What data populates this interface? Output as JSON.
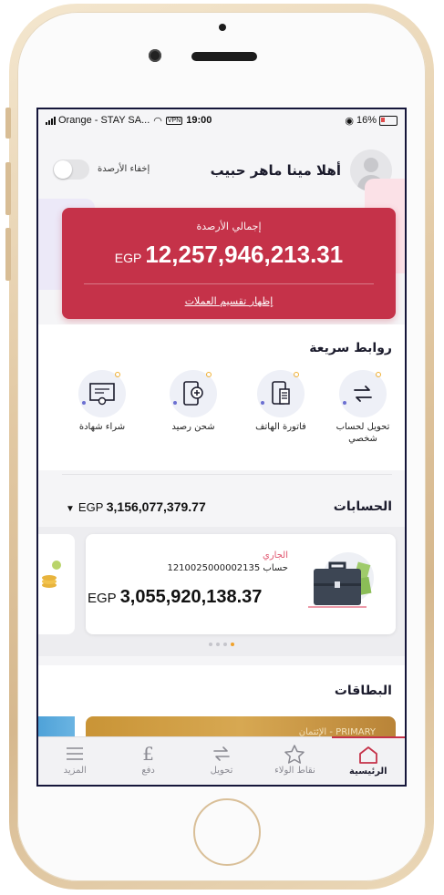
{
  "status_bar": {
    "carrier": "Orange - STAY SA...",
    "vpn": "VPN",
    "time": "19:00",
    "battery": "16%"
  },
  "header": {
    "greeting": "أهلا مينا ماهر حبيب",
    "hide_balances_label": "إخفاء الأرصدة"
  },
  "balance_card": {
    "label": "إجمالي الأرصدة",
    "currency": "EGP",
    "amount": "12,257,946,213.31",
    "link": "إظهار تقسيم العملات",
    "color": "#c53249"
  },
  "quick_links": {
    "title": "روابط سريعة",
    "items": [
      {
        "label": "تحويل لحساب شخصي",
        "icon": "transfer-icon"
      },
      {
        "label": "فاتورة الهاتف",
        "icon": "phone-bill-icon"
      },
      {
        "label": "شحن رصيد",
        "icon": "phone-topup-icon"
      },
      {
        "label": "شراء شهادة",
        "icon": "certificate-icon"
      }
    ]
  },
  "accounts": {
    "title": "الحسابات",
    "total_currency": "EGP",
    "total_amount": "3,156,077,379.77",
    "card": {
      "type": "الجاري",
      "number": "حساب 1210025000002135",
      "currency": "EGP",
      "amount": "3,055,920,138.37"
    }
  },
  "cards": {
    "title": "البطاقات",
    "card_label": "الإئتمان - PRIMARY"
  },
  "tab_bar": {
    "items": [
      {
        "label": "المزيد",
        "icon": "menu-icon"
      },
      {
        "label": "دفع",
        "icon": "pound-icon"
      },
      {
        "label": "تحويل",
        "icon": "transfer-icon"
      },
      {
        "label": "نقاط الولاء",
        "icon": "star-icon"
      },
      {
        "label": "الرئيسية",
        "icon": "home-icon"
      }
    ],
    "active": "الرئيسية",
    "accent_color": "#c53249"
  }
}
